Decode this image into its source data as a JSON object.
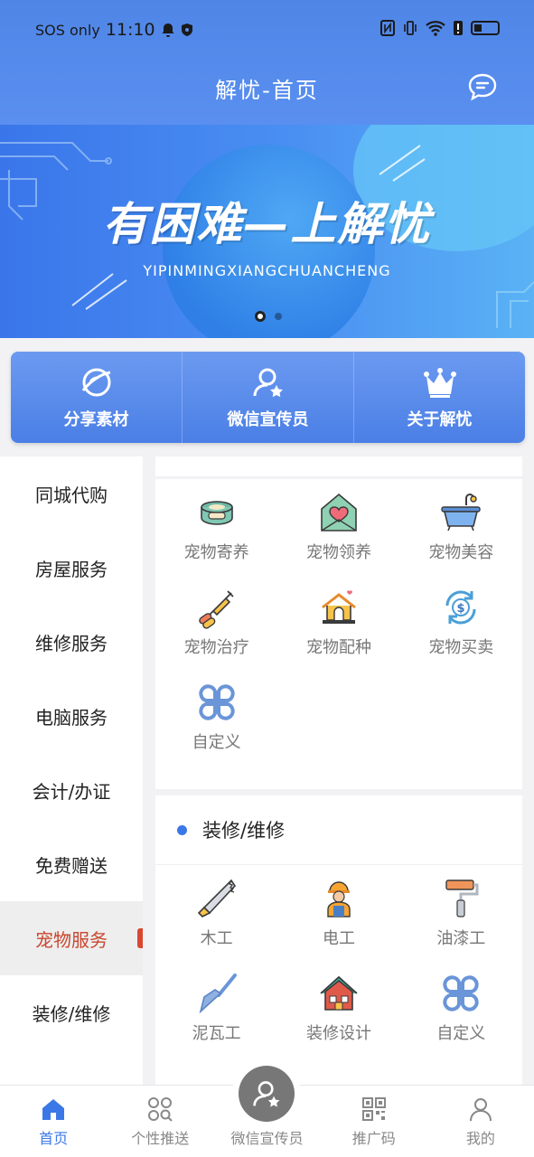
{
  "status_bar": {
    "carrier": "SOS only",
    "time": "11:10"
  },
  "header": {
    "title": "解忧-首页"
  },
  "banner": {
    "headline": "有困难—上解忧",
    "subtitle": "YIPINMINGXIANGCHUANCHENG",
    "active_slide": 1,
    "slide_count": 2
  },
  "quick_actions": [
    {
      "label": "分享素材",
      "icon": "planet-icon"
    },
    {
      "label": "微信宣传员",
      "icon": "user-star-icon"
    },
    {
      "label": "关于解忧",
      "icon": "crown-icon"
    }
  ],
  "sidebar": {
    "items": [
      {
        "label": "同城代购"
      },
      {
        "label": "房屋服务"
      },
      {
        "label": "维修服务"
      },
      {
        "label": "电脑服务"
      },
      {
        "label": "会计/办证"
      },
      {
        "label": "免费赠送"
      },
      {
        "label": "宠物服务"
      },
      {
        "label": "装修/维修"
      }
    ],
    "active": "宠物服务"
  },
  "pet_section": {
    "items": [
      {
        "label": "宠物寄养",
        "icon": "pet-bowl-icon"
      },
      {
        "label": "宠物领养",
        "icon": "heart-house-icon"
      },
      {
        "label": "宠物美容",
        "icon": "bathtub-icon"
      },
      {
        "label": "宠物治疗",
        "icon": "syringe-icon"
      },
      {
        "label": "宠物配种",
        "icon": "doghouse-icon"
      },
      {
        "label": "宠物买卖",
        "icon": "dollar-cycle-icon"
      },
      {
        "label": "自定义",
        "icon": "clover-grid-icon"
      }
    ]
  },
  "deco_section": {
    "title": "装修/维修",
    "items": [
      {
        "label": "木工",
        "icon": "saw-icon"
      },
      {
        "label": "电工",
        "icon": "worker-icon"
      },
      {
        "label": "油漆工",
        "icon": "paint-roller-icon"
      },
      {
        "label": "泥瓦工",
        "icon": "trowel-icon"
      },
      {
        "label": "装修设计",
        "icon": "house-icon"
      },
      {
        "label": "自定义",
        "icon": "clover-grid-icon"
      }
    ]
  },
  "bottom_nav": {
    "items": [
      {
        "label": "首页",
        "icon": "home-icon",
        "active": true
      },
      {
        "label": "个性推送",
        "icon": "apps-search-icon"
      },
      {
        "label": "微信宣传员",
        "icon": "user-star-icon"
      },
      {
        "label": "推广码",
        "icon": "qrcode-icon"
      },
      {
        "label": "我的",
        "icon": "person-icon"
      }
    ]
  },
  "colors": {
    "primary": "#3b78e7",
    "active_sidebar_text": "#c9472f"
  }
}
